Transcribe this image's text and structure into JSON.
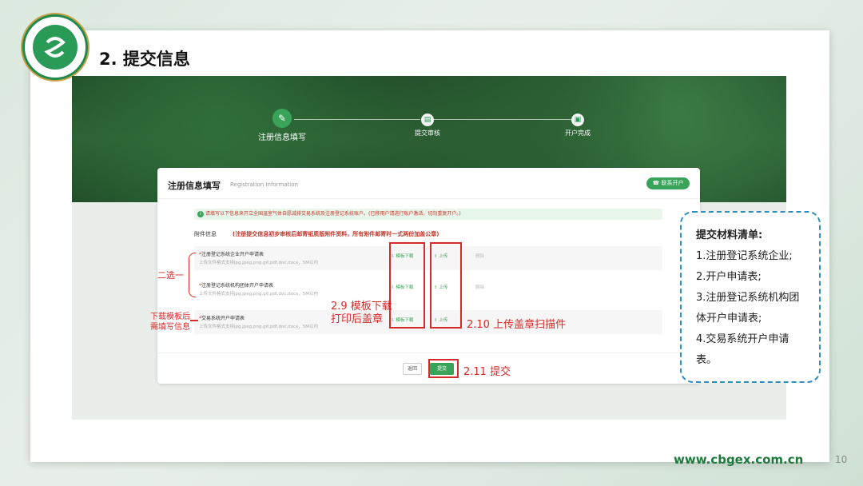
{
  "slide": {
    "title": "2. 提交信息",
    "footer_url": "www.cbgex.com.cn",
    "page_number": "10"
  },
  "steps": [
    {
      "label": "注册信息填写",
      "icon": "edit-icon"
    },
    {
      "label": "提交审核",
      "icon": "document-icon"
    },
    {
      "label": "开户完成",
      "icon": "lock-icon"
    }
  ],
  "form": {
    "title": "注册信息填写",
    "subtitle": "Registration Information",
    "contact_button": "联系开户",
    "notice": "请填写以下信息来开立全国温室气体自愿减排交易系统及注册登记系统账户。(已移用户请进行账户激活，切勿重复开户。)",
    "attachment_label": "附件信息",
    "attachment_note": "(注册提交信息初步审核后邮寄纸质版附件资料，所有附件邮寄时一式两份加盖公章)",
    "files": [
      {
        "name": "注册登记系统企业开户申请表",
        "hint": "上传文件格式支持jpg,jpeg,png,gif,pdf,doc,docx，5M以内",
        "download": "模板下载",
        "upload": "上传",
        "delete": "删除"
      },
      {
        "name": "注册登记系统机构团体开户申请表",
        "hint": "上传文件格式支持jpg,jpeg,png,gif,pdf,doc,docx，5M以内",
        "download": "模板下载",
        "upload": "上传",
        "delete": "删除"
      },
      {
        "name": "交易系统开户申请表",
        "hint": "上传文件格式支持jpg,jpeg,png,gif,pdf,doc,docx，5M以内",
        "download": "模板下载",
        "upload": "上传",
        "delete": ""
      }
    ],
    "back_button": "返回",
    "submit_button": "提交"
  },
  "annotations": {
    "choose_one": "二选一",
    "fill_after_download": "下载模板后\n需填写信息",
    "template_download": "2.9 模板下载\n打印后盖章",
    "upload_scan": "2.10 上传盖章扫描件",
    "submit": "2.11 提交"
  },
  "checklist": {
    "title": "提交材料清单:",
    "items": [
      "1.注册登记系统企业;",
      "2.开户申请表;",
      "3.注册登记系统机构团体开户申请表;",
      "4.交易系统开户申请表。"
    ]
  },
  "colors": {
    "accent": "#3aa35a",
    "annotation": "#d62b2b",
    "checklist_border": "#2f8ec0",
    "url": "#1e7a3c"
  }
}
